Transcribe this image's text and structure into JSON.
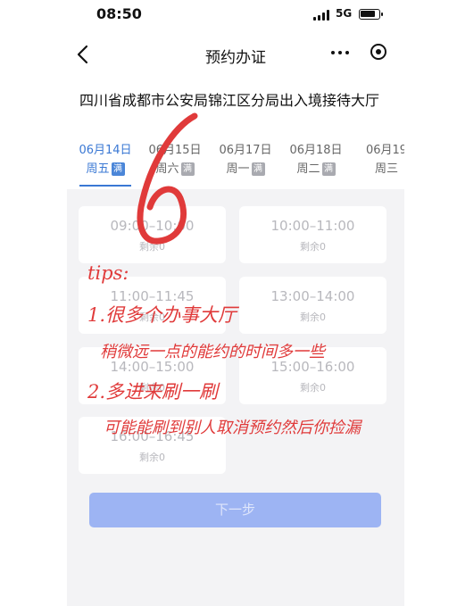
{
  "status_bar": {
    "time": "08:50",
    "network": "5G"
  },
  "nav": {
    "title": "预约办证"
  },
  "hall_name": "四川省成都市公安局锦江区分局出入境接待大厅",
  "dates": [
    {
      "date": "06月14日",
      "weekday": "周五",
      "badge": "满"
    },
    {
      "date": "06月15日",
      "weekday": "周六",
      "badge": "满"
    },
    {
      "date": "06月17日",
      "weekday": "周一",
      "badge": "满"
    },
    {
      "date": "06月18日",
      "weekday": "周二",
      "badge": "满"
    },
    {
      "date": "06月19",
      "weekday": "周三",
      "badge": ""
    }
  ],
  "slots": [
    {
      "time": "09:00–10:00",
      "remain": "剩余0"
    },
    {
      "time": "10:00–11:00",
      "remain": "剩余0"
    },
    {
      "time": "11:00–11:45",
      "remain": "剩余0"
    },
    {
      "time": "13:00–14:00",
      "remain": "剩余0"
    },
    {
      "time": "14:00–15:00",
      "remain": "剩余0"
    },
    {
      "time": "15:00–16:00",
      "remain": "剩余0"
    },
    {
      "time": "16:00–16:45",
      "remain": "剩余0"
    }
  ],
  "next_button": "下一步",
  "annotation": {
    "number": "6",
    "tips": "tips:",
    "tip1": "1.很多个办事大厅",
    "tip1_detail": "稍微远一点的能约的时间多一些",
    "tip2": "2.多进来刷一刷",
    "tip2_detail": "可能能刷到别人取消预约然后你捡漏"
  },
  "colors": {
    "accent": "#3a78d4",
    "button": "#9db4f3",
    "annotation": "#e03a3a"
  }
}
